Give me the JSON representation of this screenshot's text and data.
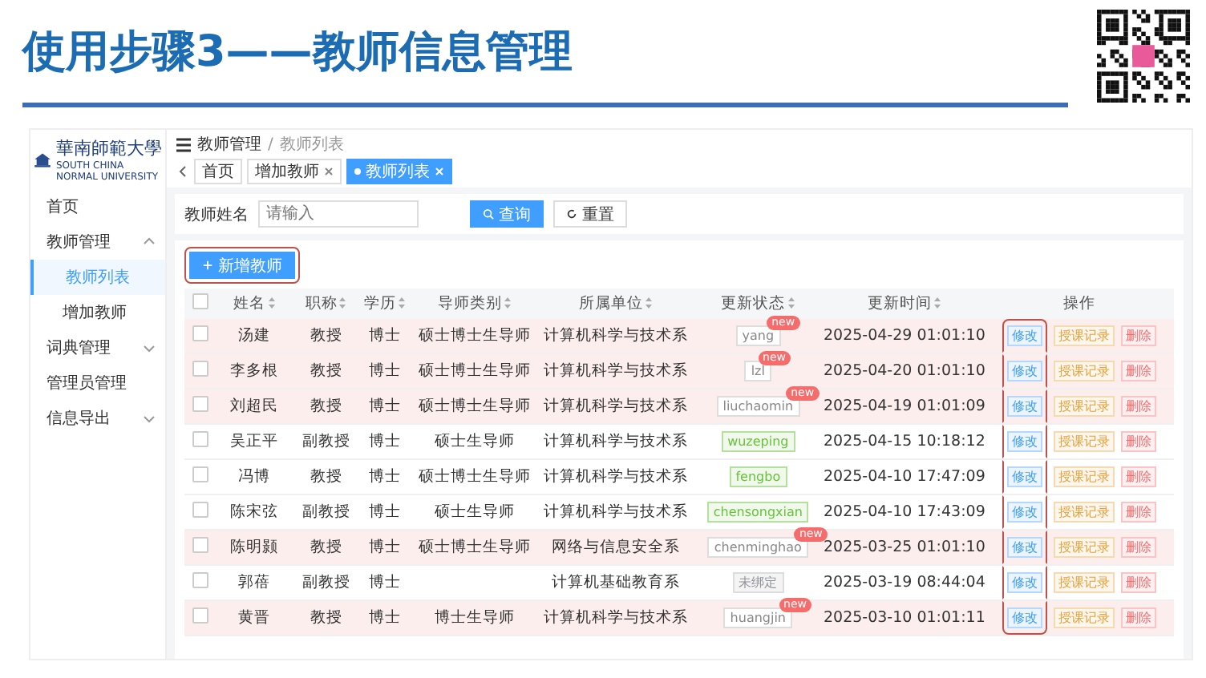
{
  "slide": {
    "title": "使用步骤3——教师信息管理"
  },
  "app": {
    "logo": {
      "name": "華南師範大學",
      "subtitle": "SOUTH CHINA NORMAL UNIVERSITY"
    },
    "sidebar": {
      "items": [
        {
          "label": "首页",
          "selected": false
        },
        {
          "label": "教师管理",
          "selected": false,
          "expanded": true,
          "children": [
            {
              "label": "教师列表",
              "selected": true
            },
            {
              "label": "增加教师",
              "selected": false
            }
          ]
        },
        {
          "label": "词典管理",
          "selected": false,
          "expanded": false
        },
        {
          "label": "管理员管理",
          "selected": false
        },
        {
          "label": "信息导出",
          "selected": false,
          "expanded": false
        }
      ]
    },
    "breadcrumb": {
      "items": [
        "教师管理",
        "教师列表"
      ],
      "separator": "/"
    },
    "tabs": [
      {
        "label": "首页",
        "selected": false,
        "closable": false
      },
      {
        "label": "增加教师",
        "selected": false,
        "closable": true
      },
      {
        "label": "教师列表",
        "selected": true,
        "closable": true
      }
    ],
    "search": {
      "label": "教师姓名",
      "placeholder": "请输入",
      "buttons": [
        {
          "label": "查询",
          "kind": "primary"
        },
        {
          "label": "重置",
          "kind": "plain"
        }
      ]
    },
    "add_button": {
      "label": "新增教师",
      "annotated": true
    },
    "table": {
      "edit_column_annotated": true,
      "all_checked": false,
      "columns": [
        {
          "label": "姓名",
          "sortable": true
        },
        {
          "label": "职称",
          "sortable": true
        },
        {
          "label": "学历",
          "sortable": true
        },
        {
          "label": "导师类别",
          "sortable": true
        },
        {
          "label": "所属单位",
          "sortable": true
        },
        {
          "label": "更新状态",
          "sortable": true
        },
        {
          "label": "更新时间",
          "sortable": true
        },
        {
          "label": "操作",
          "sortable": false
        }
      ],
      "rows": [
        {
          "checked": false,
          "highlighted": true,
          "name": "汤建",
          "title": "教授",
          "degree": "博士",
          "supervisor": "硕士博士生导师",
          "unit": "计算机科学与技术系",
          "status": {
            "text": "yang",
            "kind": "new",
            "badge": "new"
          },
          "updated": "2025-04-29 01:01:10",
          "actions": [
            {
              "label": "修改",
              "kind": "edit"
            },
            {
              "label": "授课记录",
              "kind": "record"
            },
            {
              "label": "删除",
              "kind": "delete"
            }
          ]
        },
        {
          "checked": false,
          "highlighted": true,
          "name": "李多根",
          "title": "教授",
          "degree": "博士",
          "supervisor": "硕士博士生导师",
          "unit": "计算机科学与技术系",
          "status": {
            "text": "lzl",
            "kind": "new",
            "badge": "new"
          },
          "updated": "2025-04-20 01:01:10",
          "actions": [
            {
              "label": "修改",
              "kind": "edit"
            },
            {
              "label": "授课记录",
              "kind": "record"
            },
            {
              "label": "删除",
              "kind": "delete"
            }
          ]
        },
        {
          "checked": false,
          "highlighted": true,
          "name": "刘超民",
          "title": "教授",
          "degree": "博士",
          "supervisor": "硕士博士生导师",
          "unit": "计算机科学与技术系",
          "status": {
            "text": "liuchaomin",
            "kind": "new",
            "badge": "new"
          },
          "updated": "2025-04-19 01:01:09",
          "actions": [
            {
              "label": "修改",
              "kind": "edit"
            },
            {
              "label": "授课记录",
              "kind": "record"
            },
            {
              "label": "删除",
              "kind": "delete"
            }
          ]
        },
        {
          "checked": false,
          "highlighted": false,
          "name": "吴正平",
          "title": "副教授",
          "degree": "博士",
          "supervisor": "硕士生导师",
          "unit": "计算机科学与技术系",
          "status": {
            "text": "wuzeping",
            "kind": "ok"
          },
          "updated": "2025-04-15 10:18:12",
          "actions": [
            {
              "label": "修改",
              "kind": "edit"
            },
            {
              "label": "授课记录",
              "kind": "record"
            },
            {
              "label": "删除",
              "kind": "delete"
            }
          ]
        },
        {
          "checked": false,
          "highlighted": false,
          "name": "冯博",
          "title": "教授",
          "degree": "博士",
          "supervisor": "硕士博士生导师",
          "unit": "计算机科学与技术系",
          "status": {
            "text": "fengbo",
            "kind": "ok"
          },
          "updated": "2025-04-10 17:47:09",
          "actions": [
            {
              "label": "修改",
              "kind": "edit"
            },
            {
              "label": "授课记录",
              "kind": "record"
            },
            {
              "label": "删除",
              "kind": "delete"
            }
          ]
        },
        {
          "checked": false,
          "highlighted": false,
          "name": "陈宋弦",
          "title": "副教授",
          "degree": "博士",
          "supervisor": "硕士生导师",
          "unit": "计算机科学与技术系",
          "status": {
            "text": "chensongxian",
            "kind": "ok"
          },
          "updated": "2025-04-10 17:43:09",
          "actions": [
            {
              "label": "修改",
              "kind": "edit"
            },
            {
              "label": "授课记录",
              "kind": "record"
            },
            {
              "label": "删除",
              "kind": "delete"
            }
          ]
        },
        {
          "checked": false,
          "highlighted": true,
          "name": "陈明颢",
          "title": "教授",
          "degree": "博士",
          "supervisor": "硕士博士生导师",
          "unit": "网络与信息安全系",
          "status": {
            "text": "chenminghao",
            "kind": "new",
            "badge": "new"
          },
          "updated": "2025-03-25 01:01:10",
          "actions": [
            {
              "label": "修改",
              "kind": "edit"
            },
            {
              "label": "授课记录",
              "kind": "record"
            },
            {
              "label": "删除",
              "kind": "delete"
            }
          ]
        },
        {
          "checked": false,
          "highlighted": false,
          "name": "郭蓓",
          "title": "副教授",
          "degree": "博士",
          "unit": "计算机基础教育系",
          "status": {
            "text": "未绑定",
            "kind": "none"
          },
          "updated": "2025-03-19 08:44:04",
          "actions": [
            {
              "label": "修改",
              "kind": "edit"
            },
            {
              "label": "授课记录",
              "kind": "record"
            },
            {
              "label": "删除",
              "kind": "delete"
            }
          ]
        },
        {
          "checked": false,
          "highlighted": true,
          "name": "黄晋",
          "title": "教授",
          "degree": "博士",
          "supervisor": "博士生导师",
          "unit": "计算机科学与技术系",
          "status": {
            "text": "huangjin",
            "kind": "new",
            "badge": "new"
          },
          "updated": "2025-03-10 01:01:11",
          "actions": [
            {
              "label": "修改",
              "kind": "edit"
            },
            {
              "label": "授课记录",
              "kind": "record"
            },
            {
              "label": "删除",
              "kind": "delete"
            }
          ]
        }
      ]
    }
  }
}
